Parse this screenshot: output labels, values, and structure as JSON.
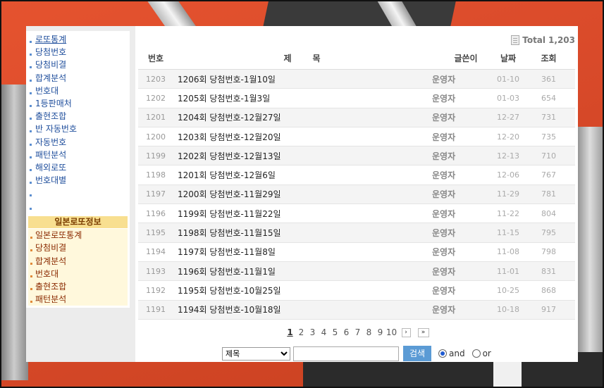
{
  "sidebar": {
    "items": [
      {
        "label": "로또통계"
      },
      {
        "label": "당첨번호"
      },
      {
        "label": "당첨비결"
      },
      {
        "label": "합계분석"
      },
      {
        "label": "번호대"
      },
      {
        "label": "1등판매처"
      },
      {
        "label": "출현조합"
      },
      {
        "label": "반 자동번호"
      },
      {
        "label": "자동번호"
      },
      {
        "label": "패턴분석"
      },
      {
        "label": "해외로또"
      },
      {
        "label": "번호대별"
      }
    ],
    "jp_header": "일본로또정보",
    "jp_items": [
      {
        "label": "일본로또통계"
      },
      {
        "label": "당첨비결"
      },
      {
        "label": "합계분석"
      },
      {
        "label": "번호대"
      },
      {
        "label": "출현조합"
      },
      {
        "label": "패턴분석"
      }
    ]
  },
  "board": {
    "total_label": "Total",
    "total_count": "1,203",
    "headers": {
      "num": "번호",
      "title": "제목",
      "writer": "글쓴이",
      "date": "날짜",
      "views": "조회"
    },
    "rows": [
      {
        "num": "1203",
        "title": "1206회 당첨번호-1월10일",
        "writer": "운영자",
        "date": "01-10",
        "views": "361"
      },
      {
        "num": "1202",
        "title": "1205회 당첨번호-1월3일",
        "writer": "운영자",
        "date": "01-03",
        "views": "654"
      },
      {
        "num": "1201",
        "title": "1204회 당첨번호-12월27일",
        "writer": "운영자",
        "date": "12-27",
        "views": "731"
      },
      {
        "num": "1200",
        "title": "1203회 당첨번호-12월20일",
        "writer": "운영자",
        "date": "12-20",
        "views": "735"
      },
      {
        "num": "1199",
        "title": "1202회 당첨번호-12월13일",
        "writer": "운영자",
        "date": "12-13",
        "views": "710"
      },
      {
        "num": "1198",
        "title": "1201회 당첨번호-12월6일",
        "writer": "운영자",
        "date": "12-06",
        "views": "767"
      },
      {
        "num": "1197",
        "title": "1200회 당첨번호-11월29일",
        "writer": "운영자",
        "date": "11-29",
        "views": "781"
      },
      {
        "num": "1196",
        "title": "1199회 당첨번호-11월22일",
        "writer": "운영자",
        "date": "11-22",
        "views": "804"
      },
      {
        "num": "1195",
        "title": "1198회 당첨번호-11월15일",
        "writer": "운영자",
        "date": "11-15",
        "views": "795"
      },
      {
        "num": "1194",
        "title": "1197회 당첨번호-11월8일",
        "writer": "운영자",
        "date": "11-08",
        "views": "798"
      },
      {
        "num": "1193",
        "title": "1196회 당첨번호-11월1일",
        "writer": "운영자",
        "date": "11-01",
        "views": "831"
      },
      {
        "num": "1192",
        "title": "1195회 당첨번호-10월25일",
        "writer": "운영자",
        "date": "10-25",
        "views": "868"
      },
      {
        "num": "1191",
        "title": "1194회 당첨번호-10월18일",
        "writer": "운영자",
        "date": "10-18",
        "views": "917"
      }
    ]
  },
  "pager": {
    "pages": [
      "1",
      "2",
      "3",
      "4",
      "5",
      "6",
      "7",
      "8",
      "9",
      "10"
    ],
    "current": "1",
    "next": "›",
    "last": "»"
  },
  "search": {
    "field_selected": "제목",
    "query_value": "",
    "button_label": "검색",
    "and_label": "and",
    "or_label": "or"
  }
}
